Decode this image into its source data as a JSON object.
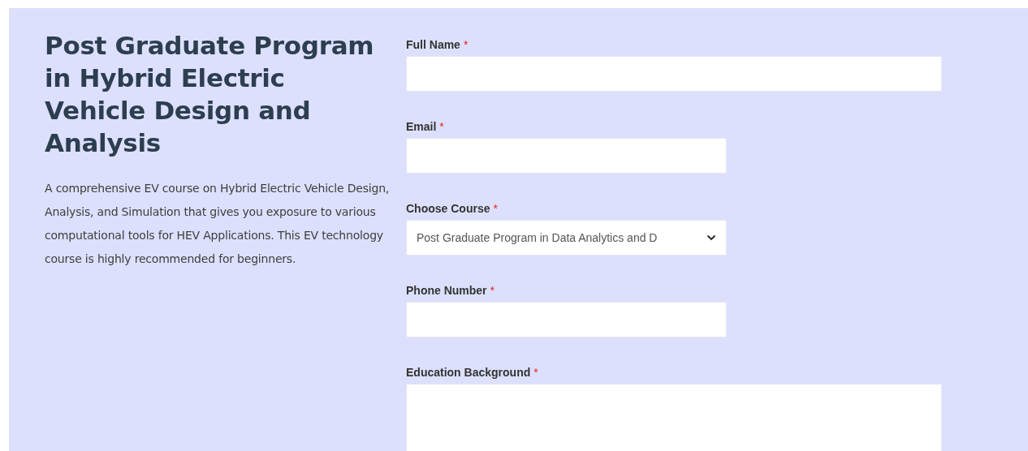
{
  "intro": {
    "title": "Post Graduate Program in Hybrid Electric Vehicle Design and Analysis",
    "description": "A comprehensive EV course on Hybrid Electric Vehicle Design, Analysis, and Simulation that gives you exposure to various computational tools for HEV Applications. This EV technology course is highly recommended for beginners."
  },
  "form": {
    "fields": [
      {
        "label": "Full Name",
        "required_mark": "*",
        "kind": "text"
      },
      {
        "label": "Email",
        "required_mark": "*",
        "kind": "email"
      },
      {
        "label": "Choose Course",
        "required_mark": "*",
        "kind": "select",
        "value": "Post Graduate Program in Data Analytics and D"
      },
      {
        "label": "Phone Number",
        "required_mark": "*",
        "kind": "tel"
      },
      {
        "label": "Education Background",
        "required_mark": "*",
        "kind": "textarea"
      }
    ]
  }
}
